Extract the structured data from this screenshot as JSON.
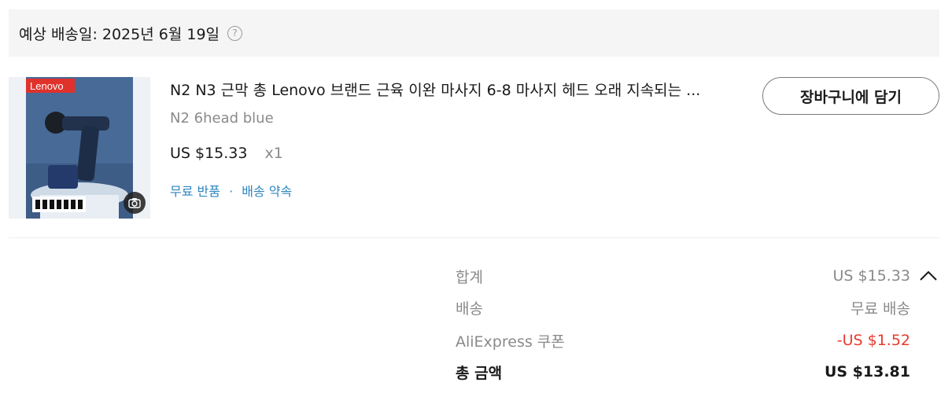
{
  "delivery": {
    "label": "예상 배송일: 2025년 6월 19일",
    "help_glyph": "?"
  },
  "product": {
    "image_brand_text": "Lenovo",
    "title": "N2 N3 근막 총 Lenovo 브랜드 근육 이완 마사지 6-8 마사지 헤드 오래 지속되는 ...",
    "variant": "N2 6head blue",
    "price": "US $15.33",
    "quantity": "x1",
    "tags": [
      "무료 반품",
      "배송 약속"
    ],
    "tag_separator": "·"
  },
  "actions": {
    "add_to_cart": "장바구니에 담기"
  },
  "summary": {
    "subtotal_label": "합계",
    "subtotal_value": "US $15.33",
    "shipping_label": "배송",
    "shipping_value": "무료 배송",
    "coupon_label": "AliExpress 쿠폰",
    "coupon_value": "-US $1.52",
    "total_label": "총 금액",
    "total_value": "US $13.81"
  },
  "colors": {
    "accent_link": "#2e86c1",
    "discount": "#e63b2e",
    "muted": "#8a8a8a"
  },
  "icons": {
    "help": "question-circle-icon",
    "camera": "camera-icon",
    "collapse": "chevron-up-icon"
  }
}
